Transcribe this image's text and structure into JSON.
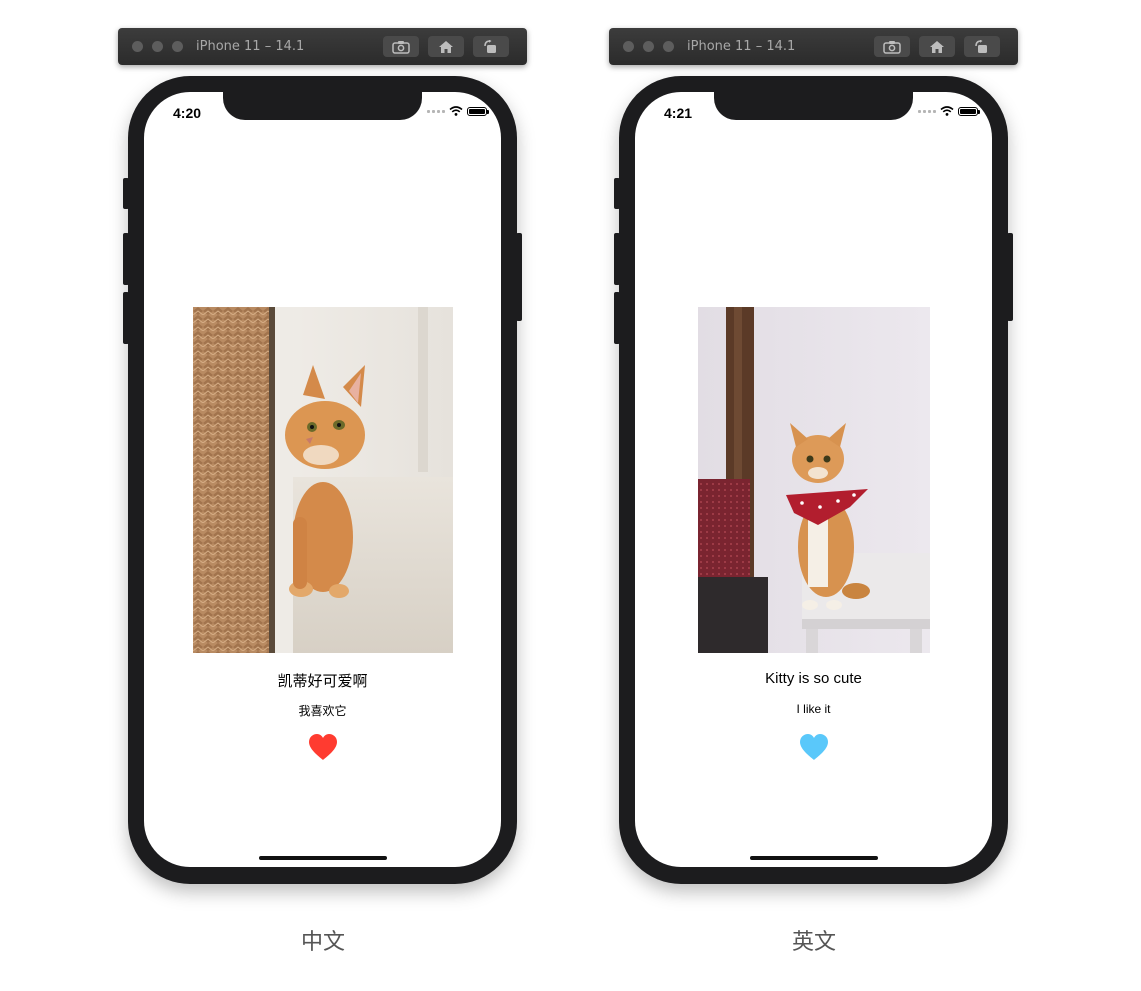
{
  "simulators": [
    {
      "window_title": "iPhone 11 – 14.1",
      "status_time": "4:20",
      "photo": "orange cat peeking behind woven basket",
      "title": "凯蒂好可爱啊",
      "subtitle": "我喜欢它",
      "heart_color": "#ff3b30",
      "caption": "中文"
    },
    {
      "window_title": "iPhone 11 – 14.1",
      "status_time": "4:21",
      "photo": "orange cat sitting on stool wearing red bandana",
      "title": "Kitty is so cute",
      "subtitle": "I like it",
      "heart_color": "#5ac8fa",
      "caption": "英文"
    }
  ],
  "icons": {
    "toolbar": [
      "screenshot-icon",
      "home-icon",
      "rotate-icon"
    ],
    "status_bar": [
      "signal-icon",
      "wifi-icon",
      "battery-icon"
    ],
    "content": "heart-icon"
  },
  "colors": {
    "titlebar": "#2b2b2b",
    "phone_frame": "#1c1c1e",
    "caption_text": "#555555"
  }
}
